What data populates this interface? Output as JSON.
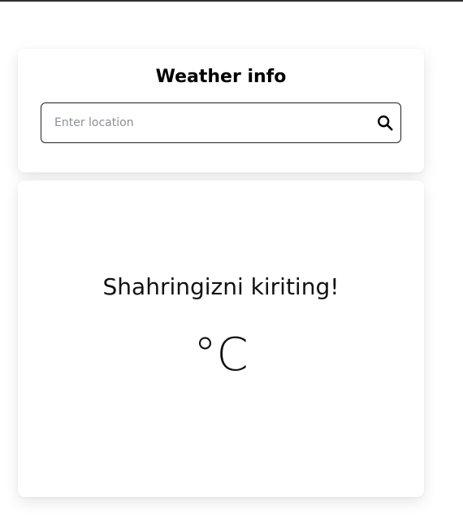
{
  "header": {
    "title": "Weather info"
  },
  "search": {
    "placeholder": "Enter location",
    "value": "",
    "icon": "search-icon"
  },
  "result": {
    "message": "Shahringizni kiriting!",
    "temperature_unit": "°C"
  }
}
